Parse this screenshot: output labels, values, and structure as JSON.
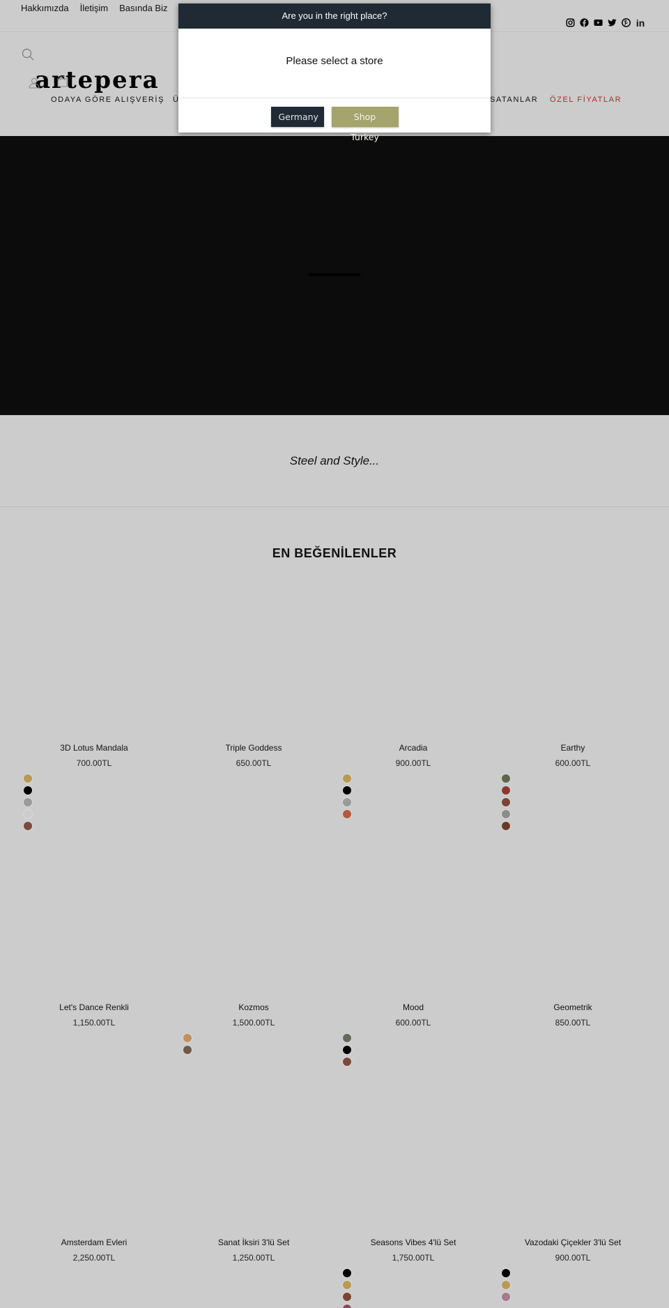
{
  "utility_nav": {
    "links": [
      "Hakkımızda",
      "İletişim",
      "Basında Biz"
    ]
  },
  "social": [
    "instagram-icon",
    "facebook-icon",
    "youtube-icon",
    "twitter-icon",
    "pinterest-icon",
    "linkedin-icon"
  ],
  "header": {
    "logo": "artepera",
    "nav": [
      {
        "label": "ODAYA GÖRE ALIŞVERİŞ"
      },
      {
        "label": "Ü"
      },
      {
        "label": "SATANLAR"
      },
      {
        "label": "ÖZEL FİYATLAR",
        "color": "#b7262a"
      }
    ]
  },
  "hero": {},
  "tagline": "Steel and Style...",
  "featured": {
    "title": "EN BEĞENİLENLER",
    "products": [
      {
        "title": "3D Lotus Mandala",
        "price": "700.00TL",
        "swatches": [
          "#b89a55",
          "#000000",
          "#9a9a9a",
          "#cccccc",
          "#7a4a3a"
        ]
      },
      {
        "title": "Triple Goddess",
        "price": "650.00TL",
        "swatches": []
      },
      {
        "title": "Arcadia",
        "price": "900.00TL",
        "swatches": [
          "#b89a55",
          "#000000",
          "#9a9a9a",
          "#b6583a"
        ]
      },
      {
        "title": "Earthy",
        "price": "600.00TL",
        "swatches": [
          "#5f6650",
          "#8a3a2e",
          "#7b4538",
          "#8c8c8c",
          "#6b3a26"
        ]
      },
      {
        "title": "Let's Dance Renkli",
        "price": "1,150.00TL",
        "swatches": []
      },
      {
        "title": "Kozmos",
        "price": "1,500.00TL",
        "swatches": [
          "#c29060",
          "#6e5a4a"
        ]
      },
      {
        "title": "Mood",
        "price": "600.00TL",
        "swatches": [
          "#65695a",
          "#000000",
          "#7a4a3a"
        ]
      },
      {
        "title": "Geometrik",
        "price": "850.00TL",
        "swatches": []
      },
      {
        "title": "Amsterdam Evleri",
        "price": "2,250.00TL",
        "swatches": []
      },
      {
        "title": "Sanat İksiri 3'lü Set",
        "price": "1,250.00TL",
        "swatches": []
      },
      {
        "title": "Seasons Vibes 4'lü Set",
        "price": "1,750.00TL",
        "swatches": [
          "#000000",
          "#b89a55",
          "#7a4530",
          "#8a4a5a"
        ]
      },
      {
        "title": "Vazodaki Çiçekler 3'lü Set",
        "price": "900.00TL",
        "swatches": [
          "#000000",
          "#b89a55",
          "#a67a8c"
        ]
      }
    ]
  },
  "modal": {
    "title": "Are you in the right place?",
    "message": "Please select a store",
    "buttons": {
      "germany": "Germany",
      "turkey": "Shop Turkey"
    },
    "colors": {
      "header": "#1f2a35",
      "germany": "#1f2a35",
      "turkey": "#a4a46c"
    }
  }
}
